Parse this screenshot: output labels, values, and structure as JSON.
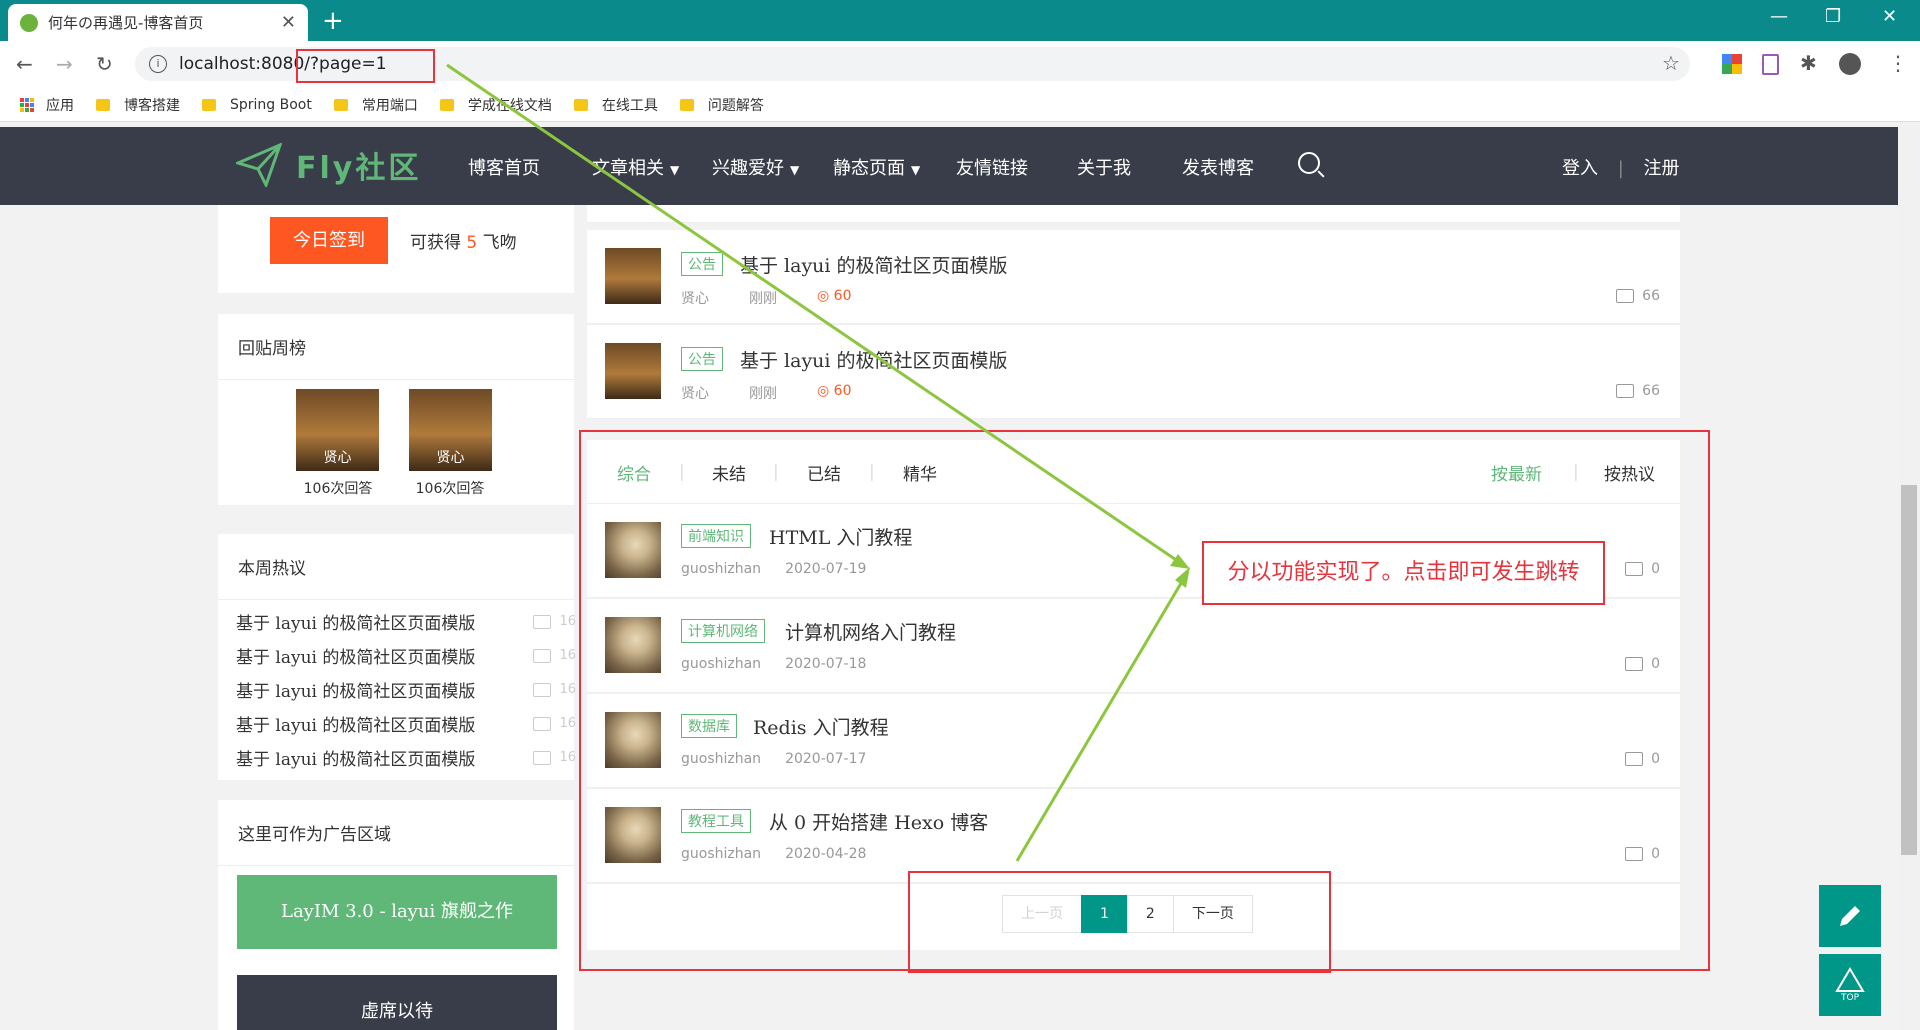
{
  "browser": {
    "tab_title": "何年の再遇见-博客首页",
    "tab_close": "✕",
    "new_tab": "+",
    "url": "localhost:8080/?page=1",
    "bookmarks": [
      "应用",
      "博客搭建",
      "Spring Boot",
      "常用端口",
      "学成在线文档",
      "在线工具",
      "问题解答"
    ]
  },
  "site": {
    "logo": "Fly社区",
    "nav": [
      "博客首页",
      "文章相关",
      "兴趣爱好",
      "静态页面",
      "友情链接",
      "关于我",
      "发表博客"
    ],
    "login": "登入",
    "divider": "|",
    "register": "注册"
  },
  "sidebar": {
    "sign_button": "今日签到",
    "sign_prefix": "可获得",
    "sign_points": "5",
    "sign_suffix": "飞吻",
    "reply_week_title": "回贴周榜",
    "reply_users": [
      {
        "name": "贤心",
        "count": "106次回答"
      },
      {
        "name": "贤心",
        "count": "106次回答"
      }
    ],
    "hot_title": "本周热议",
    "hot_items": [
      {
        "title": "基于 layui 的极简社区页面模版",
        "count": "16"
      },
      {
        "title": "基于 layui 的极简社区页面模版",
        "count": "16"
      },
      {
        "title": "基于 layui 的极简社区页面模版",
        "count": "16"
      },
      {
        "title": "基于 layui 的极简社区页面模版",
        "count": "16"
      },
      {
        "title": "基于 layui 的极简社区页面模版",
        "count": "16"
      }
    ],
    "ad_title": "这里可作为广告区域",
    "ad_green": "LayIM 3.0 - layui 旗舰之作",
    "ad_dark": "虚席以待"
  },
  "top_posts": [
    {
      "tag": "公告",
      "title": "基于 layui 的极简社区页面模版",
      "author": "贤心",
      "time": "刚刚",
      "hot": "60",
      "comments": "66"
    },
    {
      "tag": "公告",
      "title": "基于 layui 的极简社区页面模版",
      "author": "贤心",
      "time": "刚刚",
      "hot": "60",
      "comments": "66"
    }
  ],
  "filters": {
    "left": [
      "综合",
      "未结",
      "已结",
      "精华"
    ],
    "right": [
      "按最新",
      "按热议"
    ]
  },
  "posts": [
    {
      "tag": "前端知识",
      "title": "HTML 入门教程",
      "author": "guoshizhan",
      "date": "2020-07-19",
      "comments": "0"
    },
    {
      "tag": "计算机网络",
      "title": "计算机网络入门教程",
      "author": "guoshizhan",
      "date": "2020-07-18",
      "comments": "0"
    },
    {
      "tag": "数据库",
      "title": "Redis 入门教程",
      "author": "guoshizhan",
      "date": "2020-07-17",
      "comments": "0"
    },
    {
      "tag": "教程工具",
      "title": "从 0 开始搭建 Hexo 博客",
      "author": "guoshizhan",
      "date": "2020-04-28",
      "comments": "0"
    }
  ],
  "pagination": {
    "prev": "上一页",
    "pages": [
      "1",
      "2"
    ],
    "current": "1",
    "next": "下一页"
  },
  "annotation": "分以功能实现了。点击即可发生跳转",
  "colors": {
    "accent": "#5fb878",
    "teal": "#009688",
    "orange": "#ff5722",
    "annotation": "#e8333c"
  },
  "icons": {
    "fix_edit": "pencil-icon",
    "fix_top": "top-icon",
    "top_label": "TOP"
  }
}
